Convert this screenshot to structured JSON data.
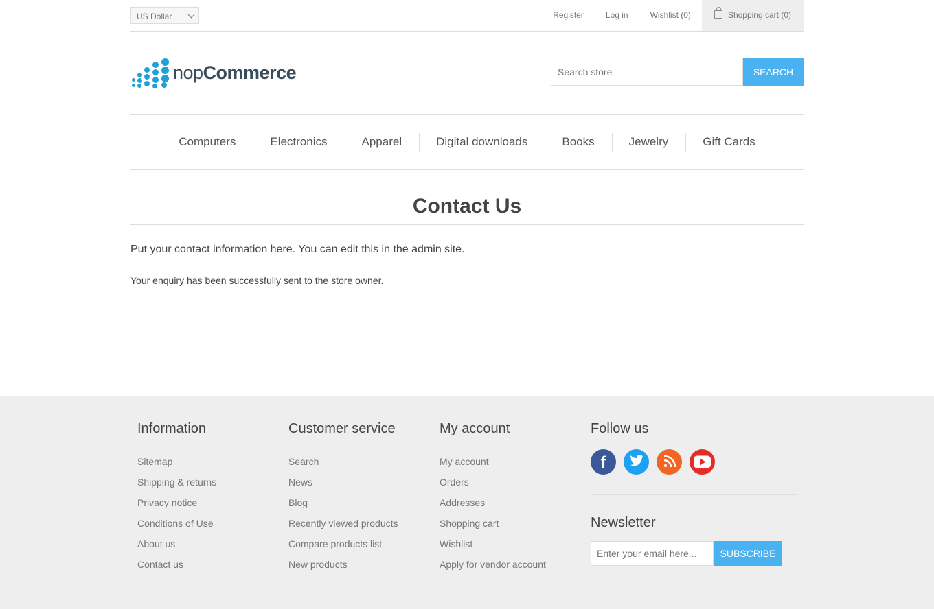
{
  "header": {
    "currency": "US Dollar",
    "links": {
      "register": "Register",
      "login": "Log in",
      "wishlist": "Wishlist (0)",
      "cart": "Shopping cart (0)"
    }
  },
  "logo": {
    "prefix": "nop",
    "suffix": "Commerce"
  },
  "search": {
    "placeholder": "Search store",
    "button": "Search"
  },
  "menu": [
    "Computers",
    "Electronics",
    "Apparel",
    "Digital downloads",
    "Books",
    "Jewelry",
    "Gift Cards"
  ],
  "page": {
    "title": "Contact Us",
    "topic": "Put your contact information here. You can edit this in the admin site.",
    "result": "Your enquiry has been successfully sent to the store owner."
  },
  "footer": {
    "information": {
      "title": "Information",
      "links": [
        "Sitemap",
        "Shipping & returns",
        "Privacy notice",
        "Conditions of Use",
        "About us",
        "Contact us"
      ]
    },
    "customer_service": {
      "title": "Customer service",
      "links": [
        "Search",
        "News",
        "Blog",
        "Recently viewed products",
        "Compare products list",
        "New products"
      ]
    },
    "my_account": {
      "title": "My account",
      "links": [
        "My account",
        "Orders",
        "Addresses",
        "Shopping cart",
        "Wishlist",
        "Apply for vendor account"
      ]
    },
    "follow": {
      "title": "Follow us",
      "social": [
        {
          "icon": "facebook-icon",
          "glyph": "f",
          "color": "#3b5998"
        },
        {
          "icon": "twitter-icon",
          "glyph": "t",
          "color": "#1da1f2"
        },
        {
          "icon": "rss-icon",
          "glyph": "rss",
          "color": "#f26522"
        },
        {
          "icon": "youtube-icon",
          "glyph": "yt",
          "color": "#e52d27"
        }
      ]
    },
    "newsletter": {
      "title": "Newsletter",
      "placeholder": "Enter your email here...",
      "button": "Subscribe"
    }
  },
  "colors": {
    "accent": "#4ab2f1",
    "logo_blue": "#1fa1d9"
  }
}
